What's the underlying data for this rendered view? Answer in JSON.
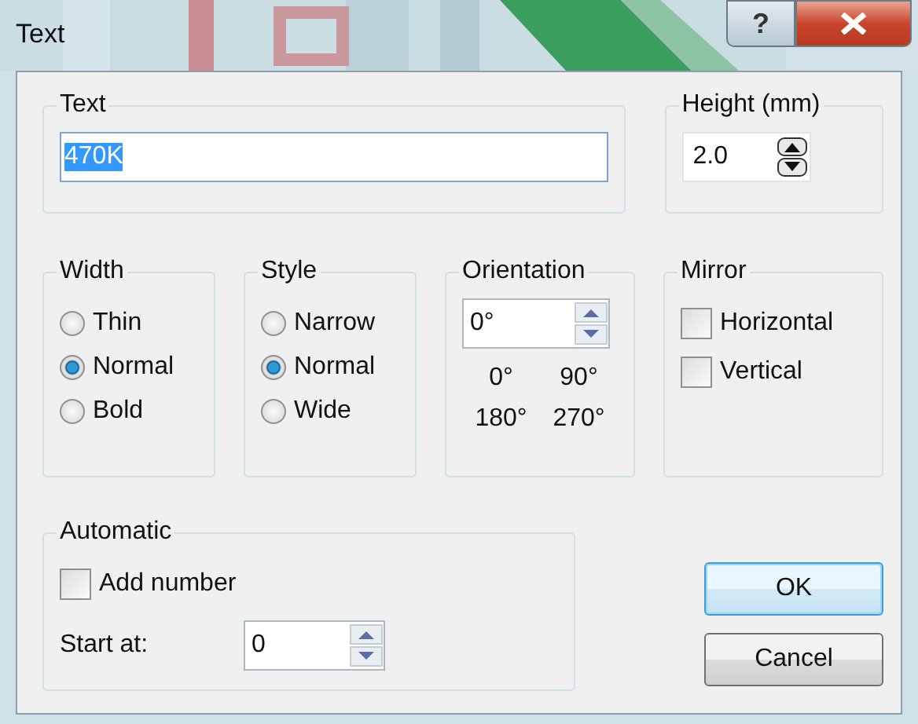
{
  "window": {
    "title": "Text",
    "help_label": "?"
  },
  "text_group": {
    "label": "Text",
    "value": "470K",
    "text_selected": true
  },
  "height_group": {
    "label": "Height (mm)",
    "value": "2.0"
  },
  "width_group": {
    "label": "Width",
    "options": [
      {
        "label": "Thin",
        "selected": false
      },
      {
        "label": "Normal",
        "selected": true
      },
      {
        "label": "Bold",
        "selected": false
      }
    ]
  },
  "style_group": {
    "label": "Style",
    "options": [
      {
        "label": "Narrow",
        "selected": false
      },
      {
        "label": "Normal",
        "selected": true
      },
      {
        "label": "Wide",
        "selected": false
      }
    ]
  },
  "orientation_group": {
    "label": "Orientation",
    "value": "0°",
    "presets": [
      "0°",
      "90°",
      "180°",
      "270°"
    ]
  },
  "mirror_group": {
    "label": "Mirror",
    "options": [
      {
        "label": "Horizontal",
        "checked": false
      },
      {
        "label": "Vertical",
        "checked": false
      }
    ]
  },
  "automatic_group": {
    "label": "Automatic",
    "add_number": {
      "label": "Add number",
      "checked": false
    },
    "start_at": {
      "label": "Start at:",
      "value": "0"
    }
  },
  "buttons": [
    {
      "label": "OK",
      "default": true
    },
    {
      "label": "Cancel",
      "default": false
    }
  ]
}
